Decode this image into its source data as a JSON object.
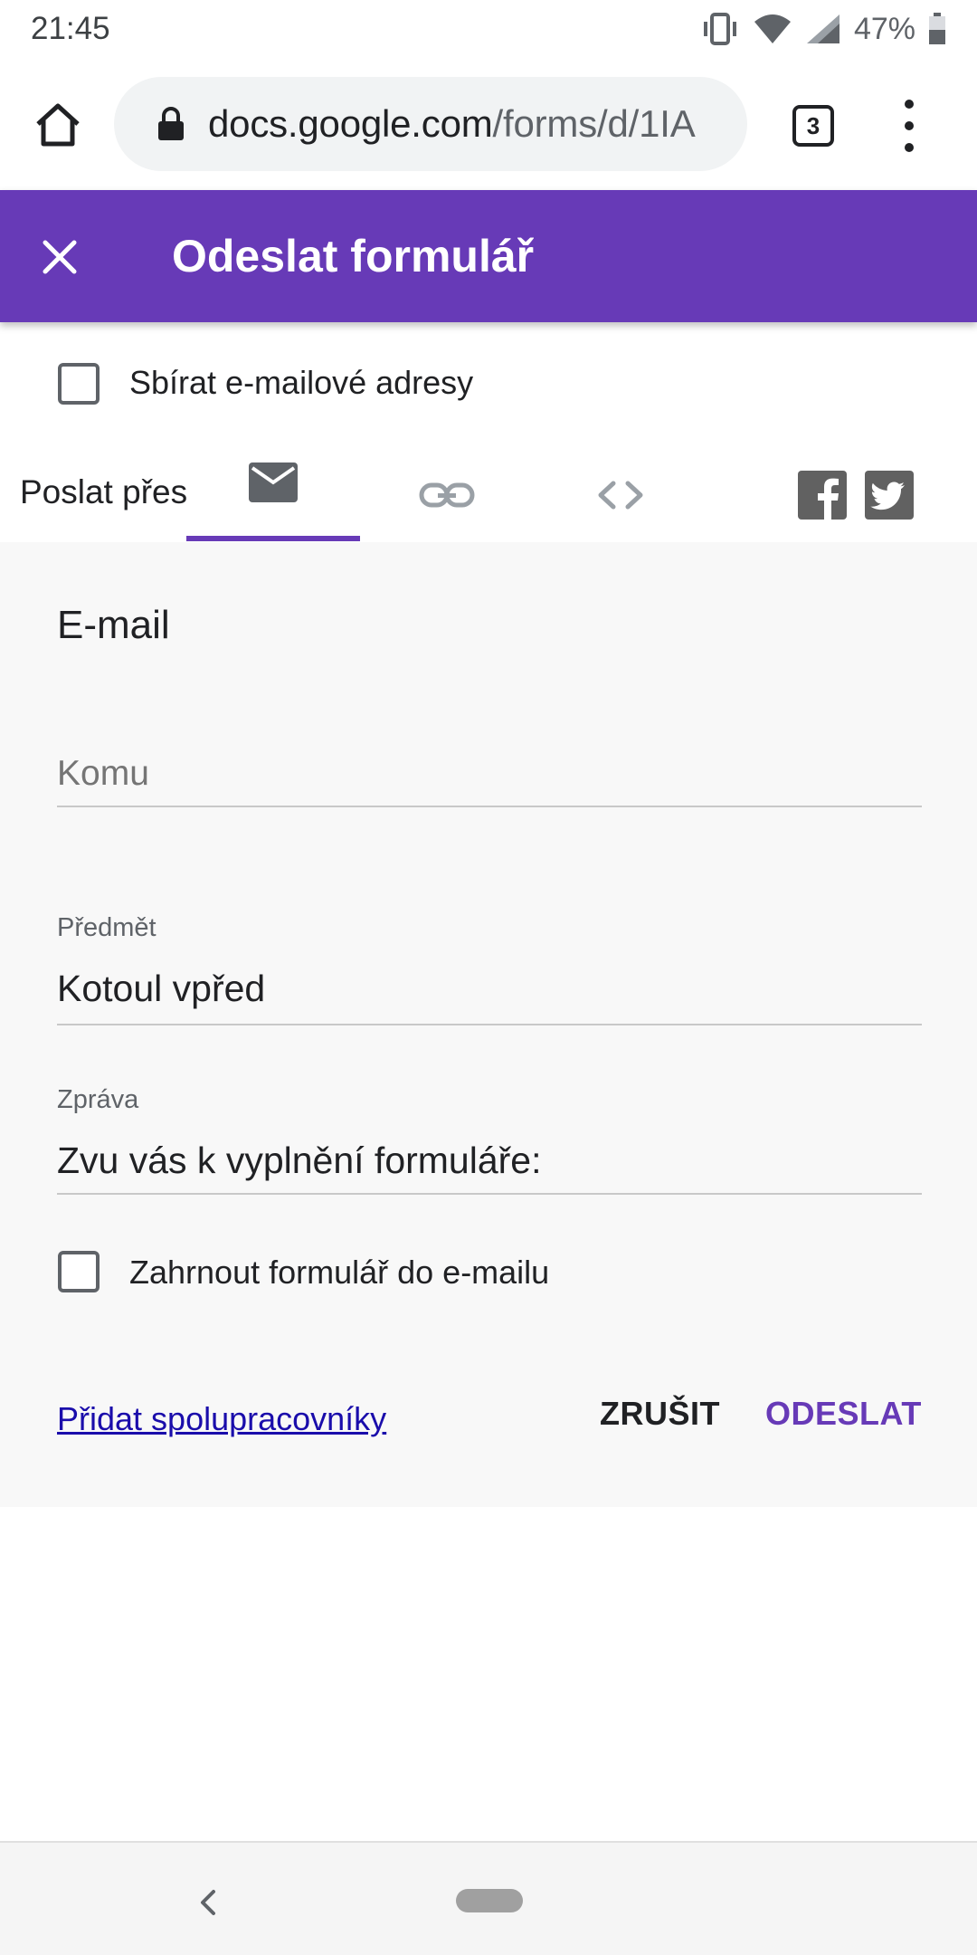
{
  "status_bar": {
    "time": "21:45",
    "battery": "47%",
    "icons": [
      "vibrate-icon",
      "wifi-icon",
      "signal-icon",
      "battery-icon"
    ]
  },
  "browser": {
    "url_domain": "docs.google.com",
    "url_path": "/forms/d/1IA",
    "tab_count": "3",
    "icons": [
      "home-icon",
      "lock-icon",
      "tabs-icon",
      "overflow-menu-icon"
    ]
  },
  "dialog": {
    "title": "Odeslat formulář",
    "collect_emails_label": "Sbírat e-mailové adresy",
    "collect_emails_checked": false,
    "send_via_label": "Poslat přes",
    "send_tabs": [
      {
        "name": "email",
        "icon": "envelope-icon",
        "selected": true
      },
      {
        "name": "link",
        "icon": "link-icon",
        "selected": false
      },
      {
        "name": "embed",
        "icon": "embed-code-icon",
        "selected": false
      }
    ],
    "share": [
      "facebook-icon",
      "twitter-icon"
    ]
  },
  "email_panel": {
    "title": "E-mail",
    "to_placeholder": "Komu",
    "to_value": "",
    "subject_label": "Předmět",
    "subject_value": "Kotoul vpřed",
    "message_label": "Zpráva",
    "message_value": "Zvu vás k vyplnění formuláře:",
    "include_form_label": "Zahrnout formulář do e-mailu",
    "include_form_checked": false,
    "add_collaborators": "Přidat spolupracovníky",
    "cancel": "ZRUŠIT",
    "send": "ODESLAT"
  },
  "colors": {
    "accent": "#673ab7",
    "link": "#1a0dab",
    "panel_bg": "#f8f8f8"
  }
}
